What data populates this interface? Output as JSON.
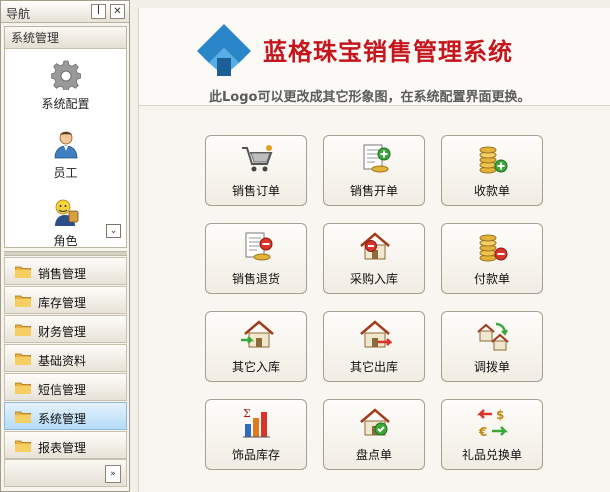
{
  "nav": {
    "title": "导航",
    "pin_glyph": "ꟾ",
    "close_glyph": "✕",
    "section_title": "系统管理",
    "system_items": [
      {
        "label": "系统配置",
        "icon": "gear-icon"
      },
      {
        "label": "员工",
        "icon": "user-icon"
      },
      {
        "label": "角色",
        "icon": "role-icon"
      }
    ],
    "scroll_glyph": "⌄",
    "groups": [
      {
        "label": "销售管理",
        "icon": "folder-icon",
        "active": false
      },
      {
        "label": "库存管理",
        "icon": "folder-icon",
        "active": false
      },
      {
        "label": "财务管理",
        "icon": "folder-icon",
        "active": false
      },
      {
        "label": "基础资料",
        "icon": "folder-icon",
        "active": false
      },
      {
        "label": "短信管理",
        "icon": "folder-icon",
        "active": false
      },
      {
        "label": "系统管理",
        "icon": "folder-icon",
        "active": true
      },
      {
        "label": "报表管理",
        "icon": "folder-icon",
        "active": false
      }
    ],
    "more_glyph": "»"
  },
  "banner": {
    "title": "蓝格珠宝销售管理系统",
    "subtitle": "此Logo可以更改成其它形象图，在系统配置界面更换。",
    "title_color": "#c4161c",
    "logo_color": "#2a86c8"
  },
  "tiles": [
    {
      "label": "销售订单",
      "icon": "shopping-cart-icon"
    },
    {
      "label": "销售开单",
      "icon": "sales-doc-add-icon"
    },
    {
      "label": "收款单",
      "icon": "coins-add-icon"
    },
    {
      "label": "销售退货",
      "icon": "sales-doc-remove-icon"
    },
    {
      "label": "采购入库",
      "icon": "house-remove-icon"
    },
    {
      "label": "付款单",
      "icon": "coins-remove-icon"
    },
    {
      "label": "其它入库",
      "icon": "house-in-icon"
    },
    {
      "label": "其它出库",
      "icon": "house-out-icon"
    },
    {
      "label": "调拨单",
      "icon": "transfer-icon"
    },
    {
      "label": "饰品库存",
      "icon": "bar-chart-sigma-icon"
    },
    {
      "label": "盘点单",
      "icon": "house-check-icon"
    },
    {
      "label": "礼品兑换单",
      "icon": "currency-exchange-icon"
    }
  ]
}
